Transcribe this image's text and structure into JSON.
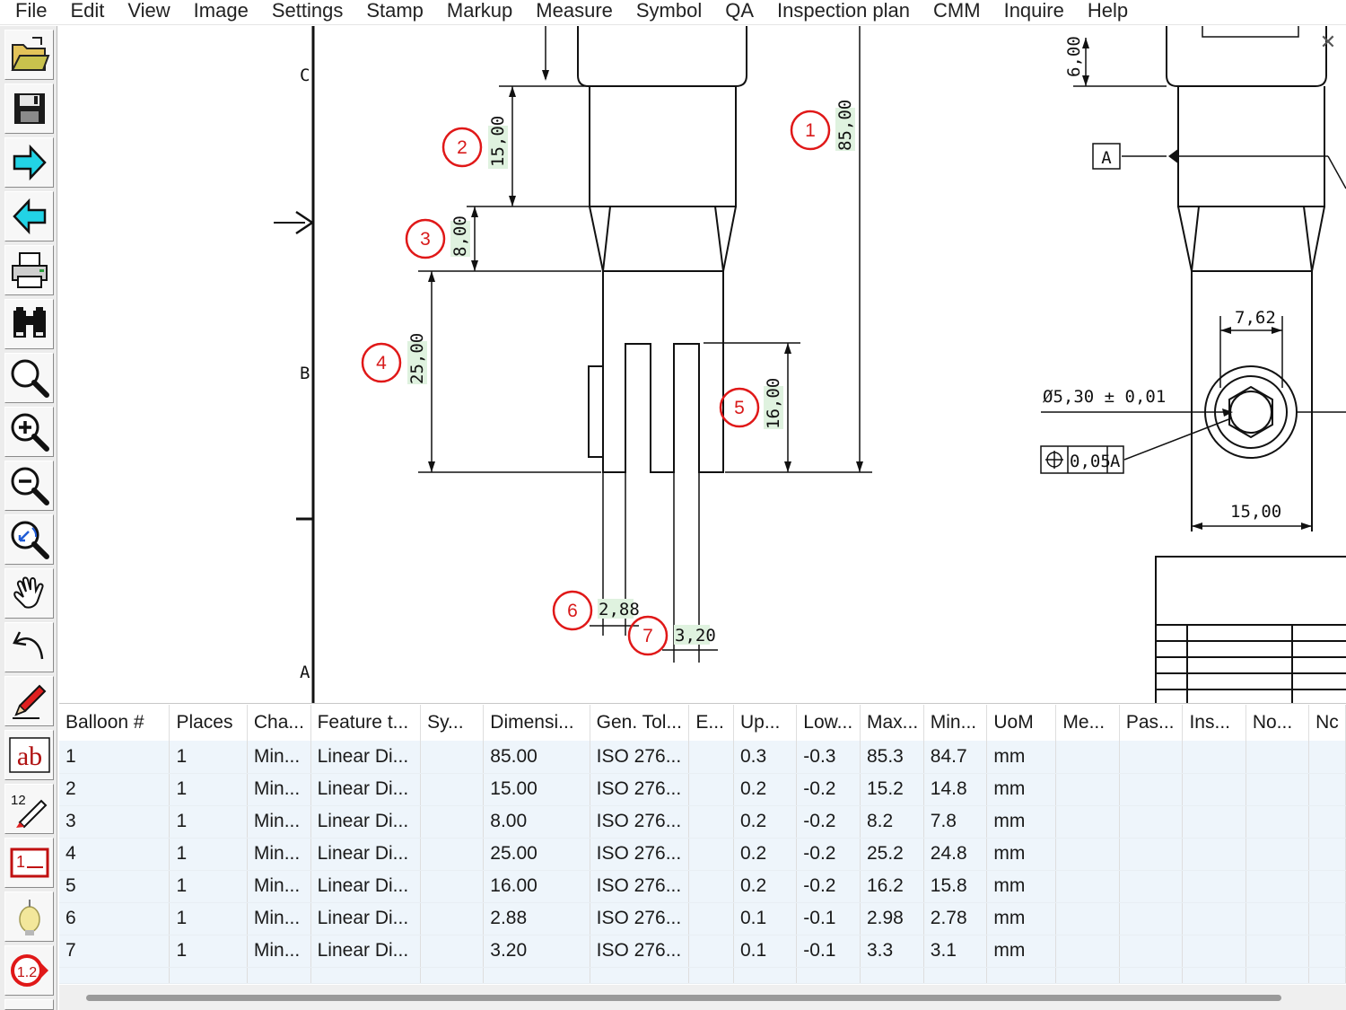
{
  "menu": [
    "File",
    "Edit",
    "View",
    "Image",
    "Settings",
    "Stamp",
    "Markup",
    "Measure",
    "Symbol",
    "QA",
    "Inspection plan",
    "CMM",
    "Inquire",
    "Help"
  ],
  "toolbar": [
    {
      "icon": "open-folder-icon"
    },
    {
      "icon": "save-icon"
    },
    {
      "icon": "arrow-right-icon"
    },
    {
      "icon": "arrow-left-icon"
    },
    {
      "icon": "print-icon"
    },
    {
      "icon": "binoculars-icon"
    },
    {
      "icon": "zoom-icon"
    },
    {
      "icon": "zoom-in-icon"
    },
    {
      "icon": "zoom-out-icon"
    },
    {
      "icon": "zoom-previous-icon"
    },
    {
      "icon": "pan-hand-icon"
    },
    {
      "icon": "undo-icon"
    },
    {
      "icon": "pencil-icon"
    },
    {
      "icon": "text-ab-icon",
      "label": "ab"
    },
    {
      "icon": "auto-balloon-icon",
      "label": "12"
    },
    {
      "icon": "list-icon",
      "label": "1"
    },
    {
      "icon": "lightbulb-icon"
    },
    {
      "icon": "balloon-number-icon",
      "label": "1.2"
    }
  ],
  "drawing": {
    "zone_labels": {
      "c": "C",
      "b": "B",
      "a": "A"
    },
    "dimensions": {
      "d85": "85,00",
      "d15": "15,00",
      "d8": "8,00",
      "d25": "25,00",
      "d16": "16,00",
      "d288": "2,88",
      "d320": "3,20",
      "d6": "6,00",
      "d762": "7,62",
      "d1500": "15,00",
      "dia": "Ø5,30 ± 0,01",
      "gdt_tol": "0,05",
      "gdt_datum": "A",
      "datum_a": "A"
    },
    "balloons": [
      "1",
      "2",
      "3",
      "4",
      "5",
      "6",
      "7"
    ],
    "close_symbol": "✕"
  },
  "table": {
    "columns": [
      "Balloon #",
      "Places",
      "Cha...",
      "Feature t...",
      "Sy...",
      "Dimensi...",
      "Gen. Tol...",
      "E...",
      "Up...",
      "Low...",
      "Max...",
      "Min...",
      "UoM",
      "Me...",
      "Pas...",
      "Ins...",
      "No...",
      "Nc"
    ],
    "rows": [
      [
        "1",
        "1",
        "Min...",
        "Linear Di...",
        "",
        "85.00",
        "ISO 276...",
        "",
        "0.3",
        "-0.3",
        "85.3",
        "84.7",
        "mm",
        "",
        "",
        "",
        "",
        ""
      ],
      [
        "2",
        "1",
        "Min...",
        "Linear Di...",
        "",
        "15.00",
        "ISO 276...",
        "",
        "0.2",
        "-0.2",
        "15.2",
        "14.8",
        "mm",
        "",
        "",
        "",
        "",
        ""
      ],
      [
        "3",
        "1",
        "Min...",
        "Linear Di...",
        "",
        "8.00",
        "ISO 276...",
        "",
        "0.2",
        "-0.2",
        "8.2",
        "7.8",
        "mm",
        "",
        "",
        "",
        "",
        ""
      ],
      [
        "4",
        "1",
        "Min...",
        "Linear Di...",
        "",
        "25.00",
        "ISO 276...",
        "",
        "0.2",
        "-0.2",
        "25.2",
        "24.8",
        "mm",
        "",
        "",
        "",
        "",
        ""
      ],
      [
        "5",
        "1",
        "Min...",
        "Linear Di...",
        "",
        "16.00",
        "ISO 276...",
        "",
        "0.2",
        "-0.2",
        "16.2",
        "15.8",
        "mm",
        "",
        "",
        "",
        "",
        ""
      ],
      [
        "6",
        "1",
        "Min...",
        "Linear Di...",
        "",
        "2.88",
        "ISO 276...",
        "",
        "0.1",
        "-0.1",
        "2.98",
        "2.78",
        "mm",
        "",
        "",
        "",
        "",
        ""
      ],
      [
        "7",
        "1",
        "Min...",
        "Linear Di...",
        "",
        "3.20",
        "ISO 276...",
        "",
        "0.1",
        "-0.1",
        "3.3",
        "3.1",
        "mm",
        "",
        "",
        "",
        "",
        ""
      ]
    ]
  }
}
